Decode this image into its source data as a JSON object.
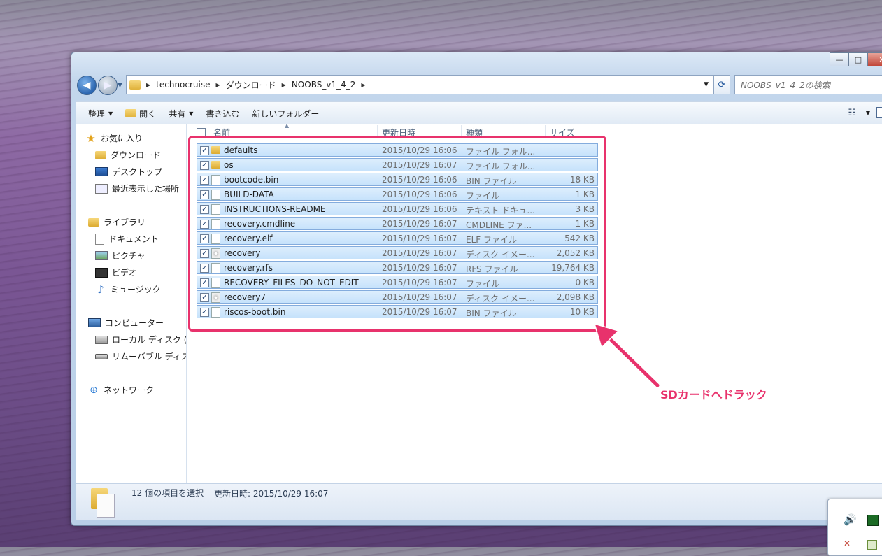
{
  "window": {
    "caption_buttons": {
      "minimize": "—",
      "maximize": "□",
      "close": "✕"
    }
  },
  "navbar": {
    "breadcrumbs": [
      "technocruise",
      "ダウンロード",
      "NOOBS_v1_4_2"
    ],
    "search_placeholder": "NOOBS_v1_4_2の検索"
  },
  "toolbar": {
    "organize": "整理",
    "open": "開く",
    "share": "共有",
    "burn": "書き込む",
    "new_folder": "新しいフォルダー"
  },
  "sidebar": {
    "favorites": {
      "label": "お気に入り",
      "items": [
        "ダウンロード",
        "デスクトップ",
        "最近表示した場所"
      ]
    },
    "libraries": {
      "label": "ライブラリ",
      "items": [
        "ドキュメント",
        "ピクチャ",
        "ビデオ",
        "ミュージック"
      ]
    },
    "computer": {
      "label": "コンピューター",
      "items": [
        "ローカル ディスク (C:)",
        "リムーバブル ディスク"
      ]
    },
    "network": {
      "label": "ネットワーク"
    }
  },
  "columns": {
    "name": "名前",
    "date": "更新日時",
    "type": "種類",
    "size": "サイズ"
  },
  "files": [
    {
      "name": "defaults",
      "date": "2015/10/29 16:06",
      "type": "ファイル フォル...",
      "size": "",
      "icon": "folder"
    },
    {
      "name": "os",
      "date": "2015/10/29 16:07",
      "type": "ファイル フォル...",
      "size": "",
      "icon": "folder"
    },
    {
      "name": "bootcode.bin",
      "date": "2015/10/29 16:06",
      "type": "BIN ファイル",
      "size": "18 KB",
      "icon": "file"
    },
    {
      "name": "BUILD-DATA",
      "date": "2015/10/29 16:06",
      "type": "ファイル",
      "size": "1 KB",
      "icon": "file"
    },
    {
      "name": "INSTRUCTIONS-README",
      "date": "2015/10/29 16:06",
      "type": "テキスト ドキュ...",
      "size": "3 KB",
      "icon": "file"
    },
    {
      "name": "recovery.cmdline",
      "date": "2015/10/29 16:07",
      "type": "CMDLINE ファ...",
      "size": "1 KB",
      "icon": "file"
    },
    {
      "name": "recovery.elf",
      "date": "2015/10/29 16:07",
      "type": "ELF ファイル",
      "size": "542 KB",
      "icon": "file"
    },
    {
      "name": "recovery",
      "date": "2015/10/29 16:07",
      "type": "ディスク イメー...",
      "size": "2,052 KB",
      "icon": "disc"
    },
    {
      "name": "recovery.rfs",
      "date": "2015/10/29 16:07",
      "type": "RFS ファイル",
      "size": "19,764 KB",
      "icon": "file"
    },
    {
      "name": "RECOVERY_FILES_DO_NOT_EDIT",
      "date": "2015/10/29 16:07",
      "type": "ファイル",
      "size": "0 KB",
      "icon": "file"
    },
    {
      "name": "recovery7",
      "date": "2015/10/29 16:07",
      "type": "ディスク イメー...",
      "size": "2,098 KB",
      "icon": "disc"
    },
    {
      "name": "riscos-boot.bin",
      "date": "2015/10/29 16:07",
      "type": "BIN ファイル",
      "size": "10 KB",
      "icon": "file"
    }
  ],
  "status": {
    "selection": "12 個の項目を選択",
    "modified": "更新日時: 2015/10/29 16:07"
  },
  "annotation": {
    "text": "SDカードへドラック",
    "color": "#e8326c"
  }
}
